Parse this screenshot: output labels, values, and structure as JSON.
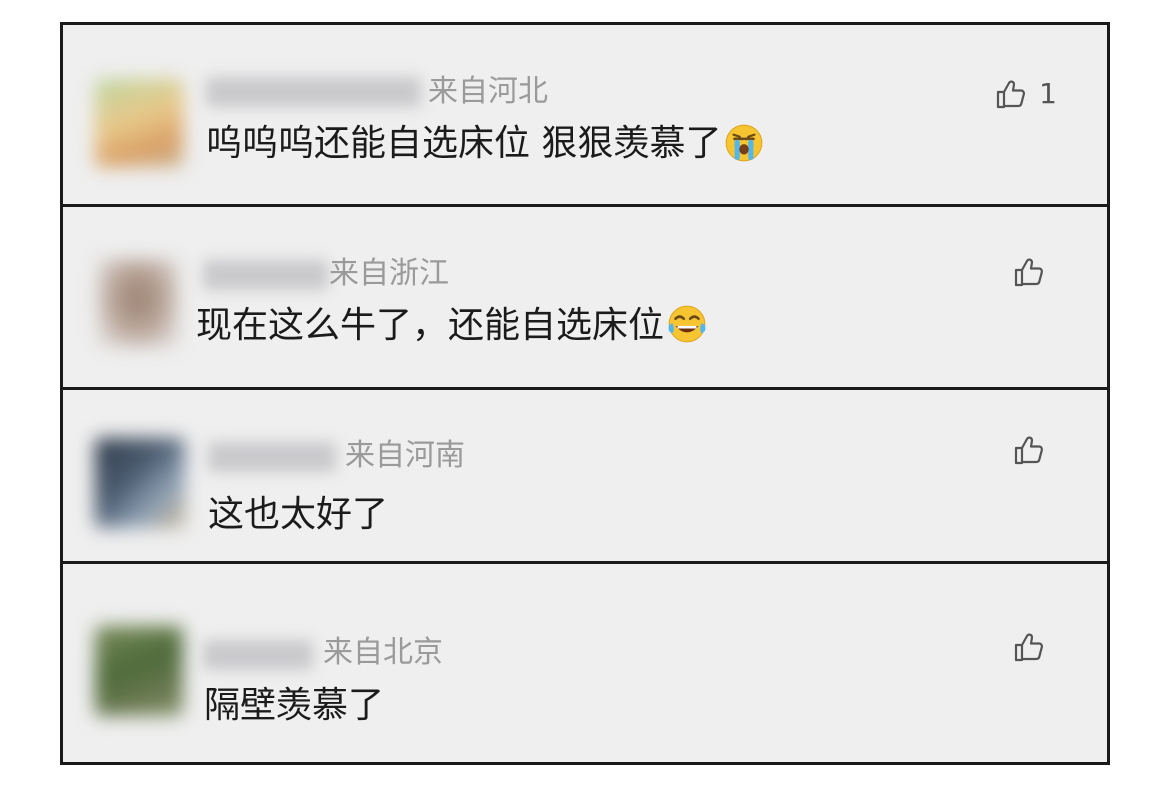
{
  "comments": [
    {
      "location": "来自河北",
      "text": "呜呜呜还能自选床位 狠狠羡慕了",
      "emoji": "crying-emoji",
      "likes": "1"
    },
    {
      "location": "来自浙江",
      "text": "现在这么牛了，还能自选床位",
      "emoji": "laughing-tears-emoji",
      "likes": ""
    },
    {
      "location": "来自河南",
      "text": "这也太好了",
      "likes": ""
    },
    {
      "location": "来自北京",
      "text": "隔壁羡慕了",
      "likes": ""
    }
  ],
  "icons": {
    "like": "thumbs-up-icon"
  },
  "colors": {
    "card_background": "#efefef",
    "card_border": "#1a1a1a",
    "location_text": "#9a9a9a",
    "comment_text": "#1b1b1b"
  }
}
